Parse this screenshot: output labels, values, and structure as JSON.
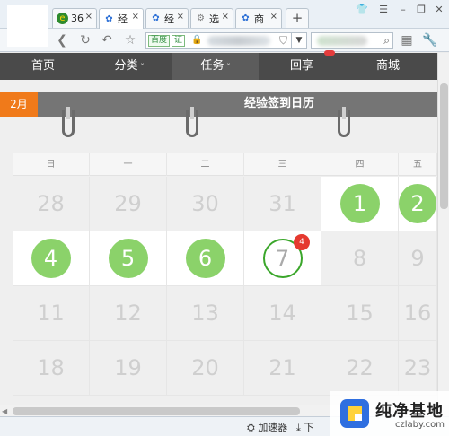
{
  "browser": {
    "tabs": [
      {
        "label": "36",
        "icon": "360-icon",
        "active": false
      },
      {
        "label": "经",
        "icon": "baidu-paw-icon",
        "active": true
      },
      {
        "label": "经",
        "icon": "baidu-paw-icon",
        "active": false
      },
      {
        "label": "选",
        "icon": "gear-icon",
        "active": false
      },
      {
        "label": "商",
        "icon": "baidu-paw-icon",
        "active": false
      }
    ],
    "close_glyph": "×",
    "new_tab": "+",
    "address": {
      "baidu_badge": "百度",
      "cert_badge": "证"
    }
  },
  "site_nav": {
    "items": [
      {
        "label": "首页",
        "has_caret": false,
        "current": false
      },
      {
        "label": "分类",
        "has_caret": true,
        "current": false
      },
      {
        "label": "任务",
        "has_caret": true,
        "current": true
      },
      {
        "label": "回享",
        "has_caret": false,
        "current": false
      },
      {
        "label": "商城",
        "has_caret": false,
        "current": false
      }
    ],
    "caret": "˅"
  },
  "calendar": {
    "month_tag": "2月",
    "title": "经验签到日历",
    "weekdays": [
      "日",
      "一",
      "二",
      "三",
      "四",
      "五"
    ],
    "rows": [
      [
        {
          "d": "28",
          "s": "other"
        },
        {
          "d": "29",
          "s": "other"
        },
        {
          "d": "30",
          "s": "other"
        },
        {
          "d": "31",
          "s": "other"
        },
        {
          "d": "1",
          "s": "signed"
        },
        {
          "d": "2",
          "s": "signed"
        }
      ],
      [
        {
          "d": "4",
          "s": "signed"
        },
        {
          "d": "5",
          "s": "signed"
        },
        {
          "d": "6",
          "s": "signed"
        },
        {
          "d": "7",
          "s": "today",
          "badge": "4"
        },
        {
          "d": "8",
          "s": "future"
        },
        {
          "d": "9",
          "s": "future"
        }
      ],
      [
        {
          "d": "11",
          "s": "future"
        },
        {
          "d": "12",
          "s": "future"
        },
        {
          "d": "13",
          "s": "future"
        },
        {
          "d": "14",
          "s": "future"
        },
        {
          "d": "15",
          "s": "future"
        },
        {
          "d": "16",
          "s": "future"
        }
      ],
      [
        {
          "d": "18",
          "s": "future"
        },
        {
          "d": "19",
          "s": "future"
        },
        {
          "d": "20",
          "s": "future"
        },
        {
          "d": "21",
          "s": "future"
        },
        {
          "d": "22",
          "s": "future"
        },
        {
          "d": "23",
          "s": "future"
        }
      ]
    ]
  },
  "status": {
    "accelerator": "加速器",
    "download": "下"
  },
  "watermark": {
    "cn": "纯净基地",
    "en": "czlaby.com"
  },
  "colors": {
    "nav_bg": "#4a4a4a",
    "month_tag": "#f07a1a",
    "signed": "#8bd26a",
    "today_ring": "#3aa62a",
    "badge": "#e5392f"
  }
}
